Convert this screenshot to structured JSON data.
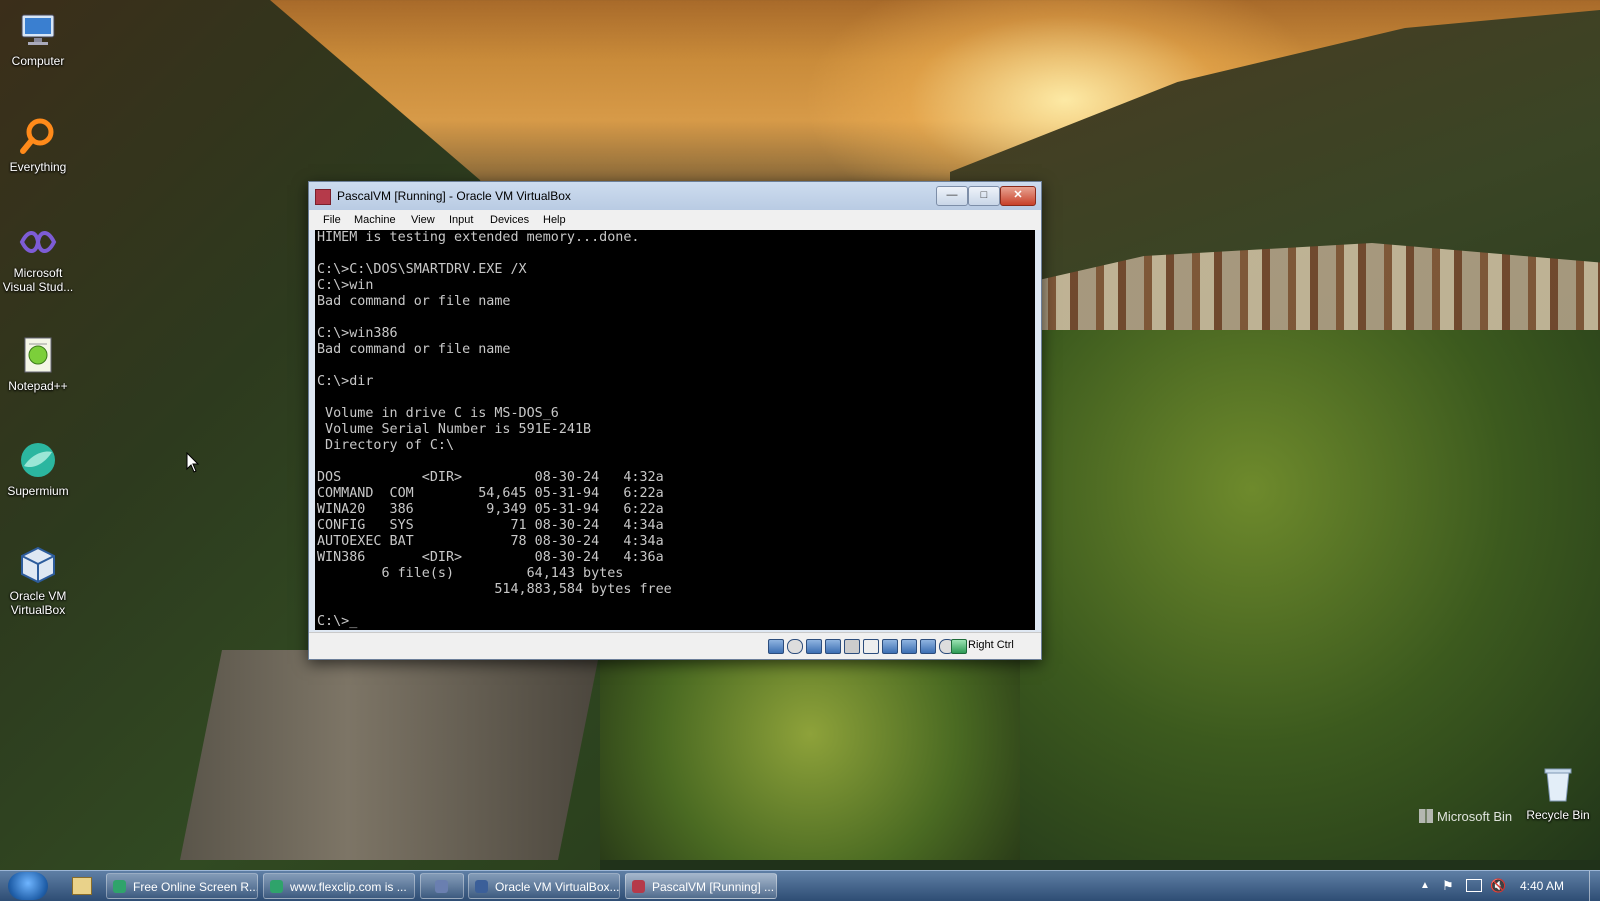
{
  "desktop": {
    "icons": [
      {
        "name": "Computer",
        "icon": "computer-icon"
      },
      {
        "name": "Everything",
        "icon": "everything-search-icon"
      },
      {
        "name": "Microsoft Visual Stud...",
        "icon": "visual-studio-icon"
      },
      {
        "name": "Notepad++",
        "icon": "notepad-plus-plus-icon"
      },
      {
        "name": "Supermium",
        "icon": "supermium-browser-icon"
      },
      {
        "name": "Oracle VM VirtualBox",
        "icon": "virtualbox-icon"
      }
    ],
    "recycle_bin": "Recycle Bin",
    "watermark": "Microsoft Bin"
  },
  "window": {
    "title": "PascalVM [Running] - Oracle VM VirtualBox",
    "menu": [
      "File",
      "Machine",
      "View",
      "Input",
      "Devices",
      "Help"
    ],
    "console_lines": [
      "HIMEM is testing extended memory...done.",
      "",
      "C:\\>C:\\DOS\\SMARTDRV.EXE /X",
      "C:\\>win",
      "Bad command or file name",
      "",
      "C:\\>win386",
      "Bad command or file name",
      "",
      "C:\\>dir",
      "",
      " Volume in drive C is MS-DOS_6",
      " Volume Serial Number is 591E-241B",
      " Directory of C:\\",
      "",
      "DOS          <DIR>         08-30-24   4:32a",
      "COMMAND  COM        54,645 05-31-94   6:22a",
      "WINA20   386         9,349 05-31-94   6:22a",
      "CONFIG   SYS            71 08-30-24   4:34a",
      "AUTOEXEC BAT            78 08-30-24   4:34a",
      "WIN386       <DIR>         08-30-24   4:36a",
      "        6 file(s)         64,143 bytes",
      "                      514,883,584 bytes free",
      "",
      "C:\\>_"
    ],
    "host_key": "Right Ctrl"
  },
  "taskbar": {
    "buttons": [
      {
        "label": "Free Online Screen R...",
        "color": "#2fa36b"
      },
      {
        "label": "www.flexclip.com is ...",
        "color": "#2fa36b"
      },
      {
        "label": "",
        "color": "#6a7fb0"
      },
      {
        "label": "Oracle VM VirtualBox...",
        "color": "#3b5f99"
      },
      {
        "label": "PascalVM [Running] ...",
        "color": "#b53a4a"
      }
    ],
    "clock": "4:40 AM"
  }
}
